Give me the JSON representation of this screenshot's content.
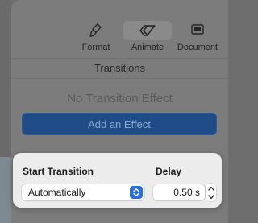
{
  "toolbar": {
    "format_label": "Format",
    "animate_label": "Animate",
    "document_label": "Document",
    "active_tab": "Animate"
  },
  "inspector": {
    "section_title": "Transitions",
    "effect_title": "No Transition Effect",
    "add_effect_label": "Add an Effect"
  },
  "popover": {
    "start_label": "Start Transition",
    "start_value": "Automatically",
    "delay_label": "Delay",
    "delay_value": "0.50 s"
  },
  "colors": {
    "accent": "#2a6fe0",
    "add_button": "#1f4b86"
  },
  "icons": {
    "format": "paintbrush-icon",
    "animate": "diamond-icon",
    "document": "document-icon",
    "select": "up-down-chevron-icon",
    "stepper_up": "chevron-up-icon",
    "stepper_down": "chevron-down-icon"
  }
}
